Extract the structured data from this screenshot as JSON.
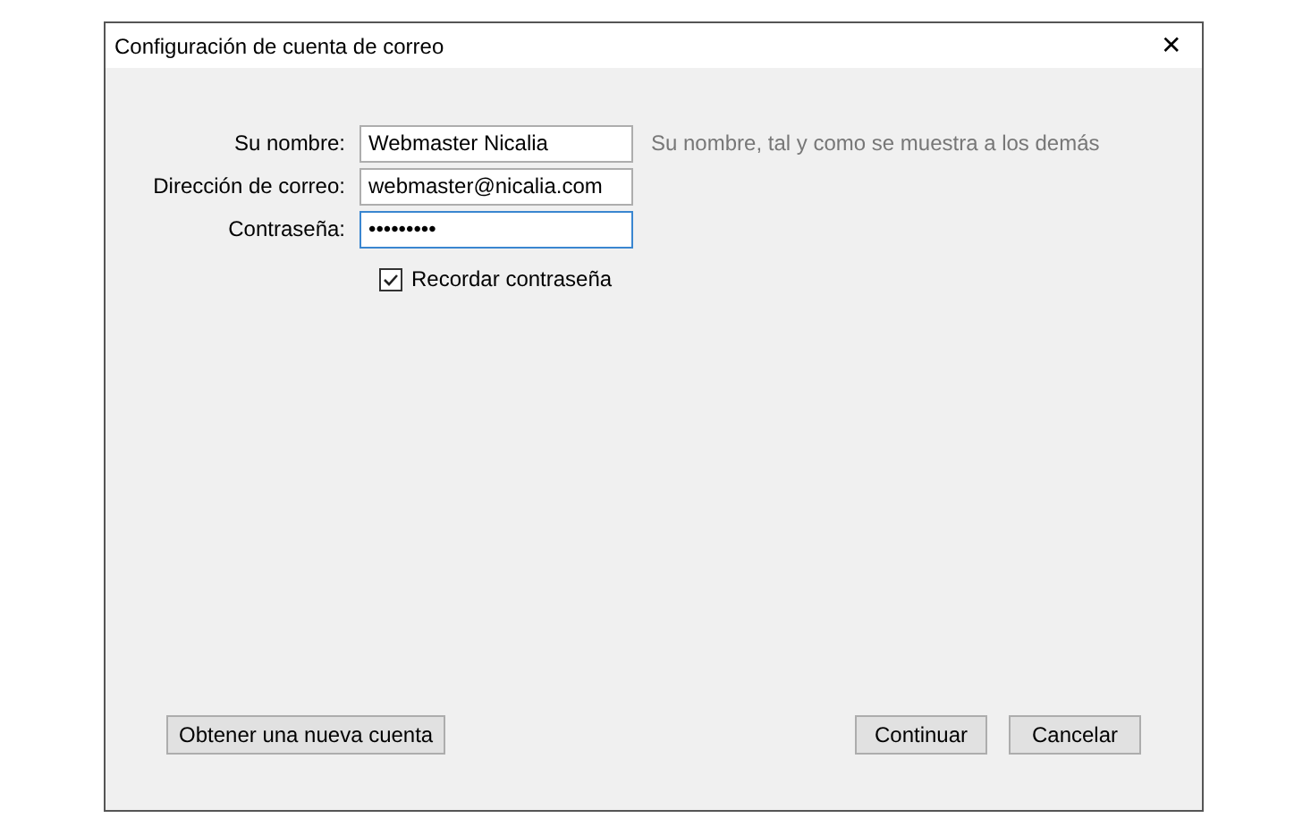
{
  "window": {
    "title": "Configuración de cuenta de correo",
    "close": "✕"
  },
  "fields": [
    {
      "label": "Su nombre:",
      "value": "Webmaster Nicalia",
      "focused": false,
      "hint": "Su nombre, tal y como se muestra a los demás"
    },
    {
      "label": "Dirección de correo:",
      "value": "webmaster@nicalia.com",
      "focused": false
    },
    {
      "label": "Contraseña:",
      "value": "•••••••••",
      "focused": true
    }
  ],
  "remember": {
    "label": "Recordar contraseña",
    "checked": true
  },
  "buttons": [
    {
      "label": "Obtener una nueva cuenta"
    },
    {
      "label": "Continuar"
    },
    {
      "label": "Cancelar"
    }
  ]
}
